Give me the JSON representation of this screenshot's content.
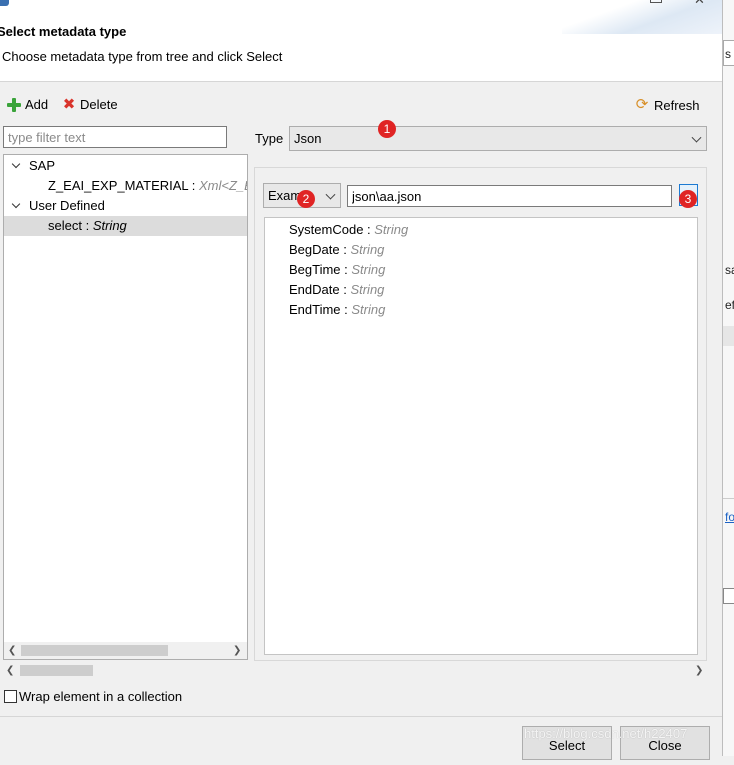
{
  "dialog": {
    "title": "Select metadata type",
    "subtitle": "Choose metadata type from tree and click Select"
  },
  "toolbar": {
    "add_label": "Add",
    "delete_label": "Delete",
    "refresh_label": "Refresh"
  },
  "filter": {
    "placeholder": "type filter text",
    "value": ""
  },
  "type_selector": {
    "label": "Type",
    "value": "Json"
  },
  "tree": {
    "groups": [
      {
        "label": "SAP",
        "children": [
          {
            "name": "Z_EAI_EXP_MATERIAL",
            "separator": " : ",
            "type": "Xml<Z_EAI_"
          }
        ]
      },
      {
        "label": "User Defined",
        "children": [
          {
            "name": "select",
            "separator": " : ",
            "type": "String"
          }
        ]
      }
    ]
  },
  "source": {
    "mode_value": "Exam",
    "path_value": "json\\aa.json"
  },
  "properties": [
    {
      "name": "SystemCode",
      "separator": " : ",
      "type": "String"
    },
    {
      "name": "BegDate",
      "separator": " : ",
      "type": "String"
    },
    {
      "name": "BegTime",
      "separator": " : ",
      "type": "String"
    },
    {
      "name": "EndDate",
      "separator": " : ",
      "type": "String"
    },
    {
      "name": "EndTime",
      "separator": " : ",
      "type": "String"
    }
  ],
  "badges": [
    "1",
    "2",
    "3"
  ],
  "wrap_collection": {
    "label": "Wrap element in a collection",
    "checked": false
  },
  "buttons": {
    "select_label": "Select",
    "close_label": "Close"
  },
  "watermark": "https://blog.csdn.net/h22407",
  "background_window": {
    "fragments": [
      "s",
      "sa",
      "efe",
      "fo"
    ]
  },
  "colors": {
    "badge": "#e02424",
    "accent": "#1c7ad2",
    "selection": "#dcdcdc"
  }
}
